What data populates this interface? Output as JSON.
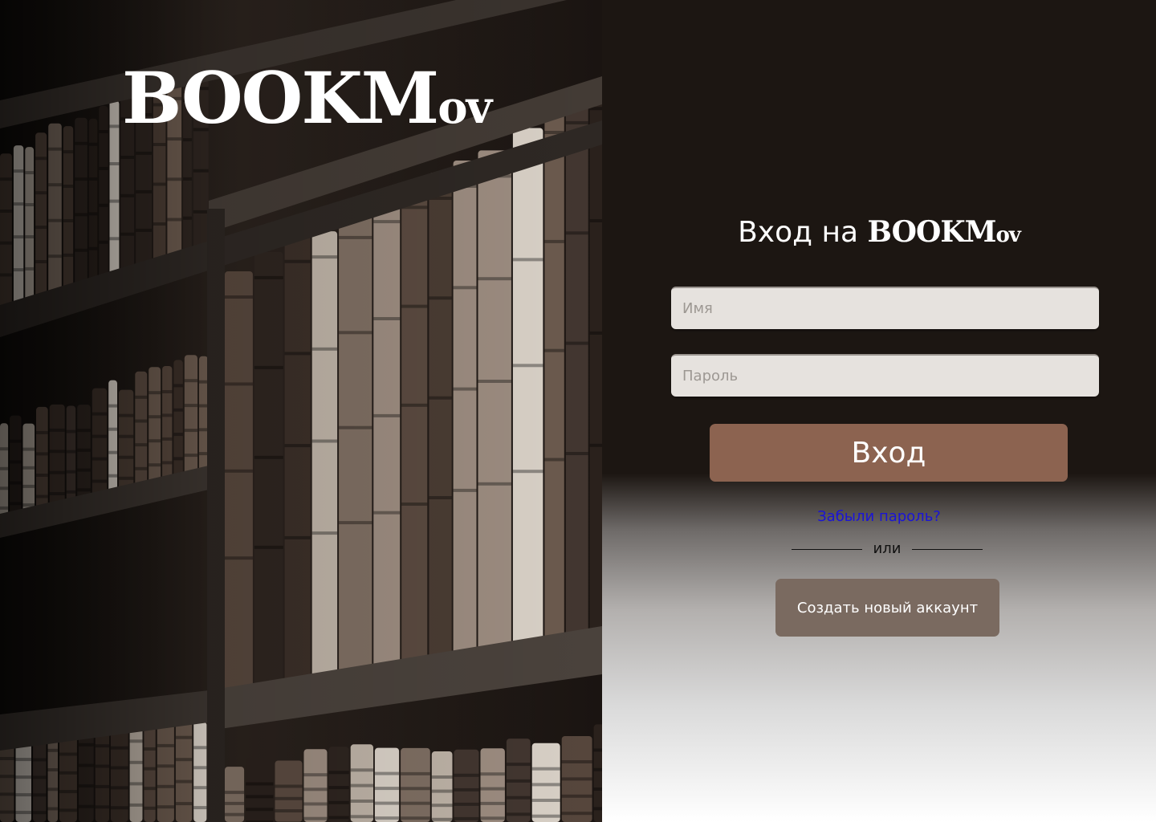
{
  "brand": {
    "logo_main": "BOOKM",
    "logo_suffix": "ov"
  },
  "form": {
    "title_prefix": "Вход на",
    "title_brand_main": "BOOKM",
    "title_brand_suffix": "ov",
    "name_placeholder": "Имя",
    "name_value": "",
    "password_placeholder": "Пароль",
    "password_value": "",
    "login_label": "Вход",
    "forgot_label": "Забыли пароль?",
    "or_label": "или",
    "create_label": "Создать новый аккаунт"
  },
  "colors": {
    "panel_dark": "#1c1612",
    "login_button": "#8c6350",
    "create_button": "#7a6a60",
    "link": "#1a14d6",
    "field_bg": "#e6e2de"
  }
}
